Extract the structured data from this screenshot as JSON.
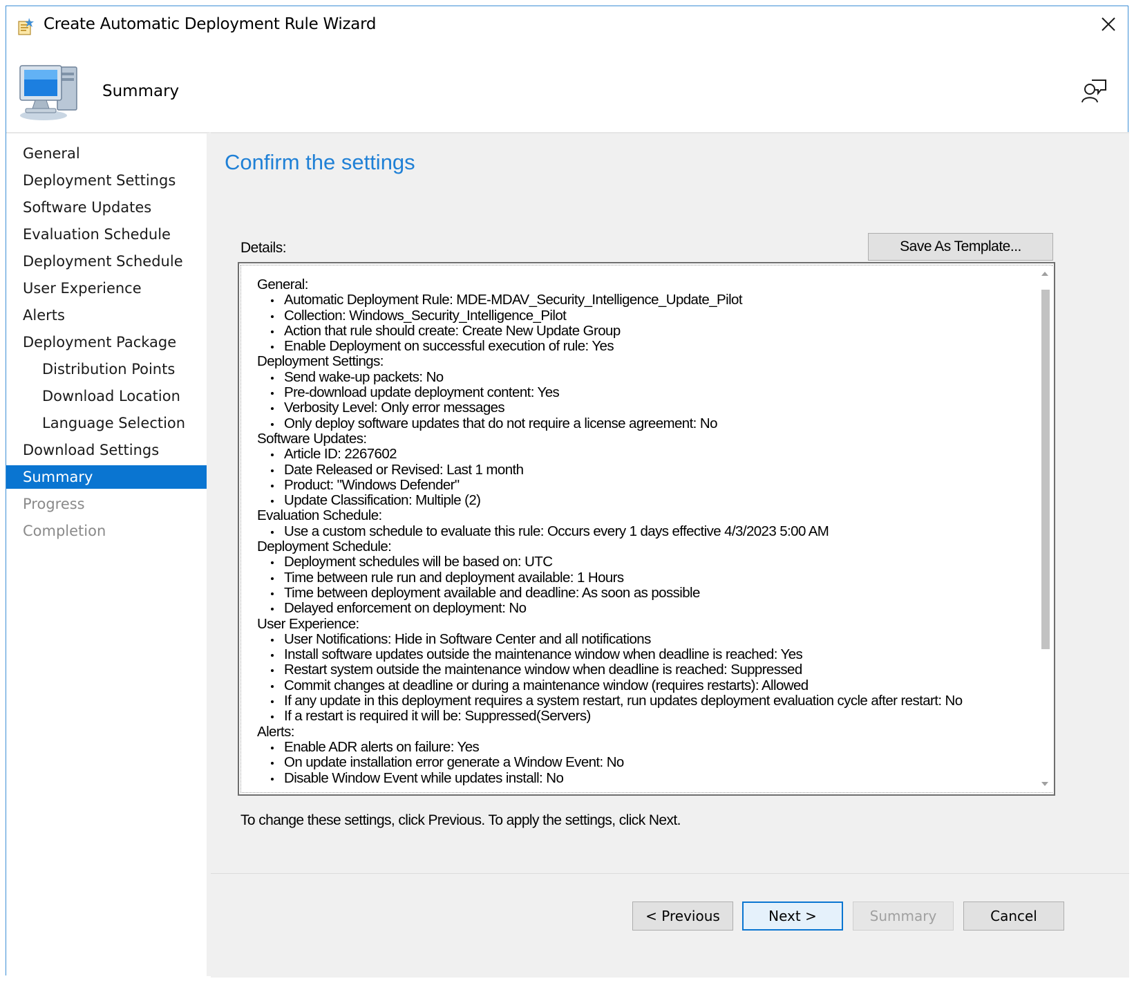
{
  "window": {
    "title": "Create Automatic Deployment Rule Wizard",
    "accent_color": "#0a75d1",
    "heading_color": "#1f80d6"
  },
  "header": {
    "page_title": "Summary"
  },
  "sidebar": {
    "items": [
      {
        "label": "General",
        "state": "normal",
        "level": 0
      },
      {
        "label": "Deployment Settings",
        "state": "normal",
        "level": 0
      },
      {
        "label": "Software Updates",
        "state": "normal",
        "level": 0
      },
      {
        "label": "Evaluation Schedule",
        "state": "normal",
        "level": 0
      },
      {
        "label": "Deployment Schedule",
        "state": "normal",
        "level": 0
      },
      {
        "label": "User Experience",
        "state": "normal",
        "level": 0
      },
      {
        "label": "Alerts",
        "state": "normal",
        "level": 0
      },
      {
        "label": "Deployment Package",
        "state": "normal",
        "level": 0
      },
      {
        "label": "Distribution Points",
        "state": "normal",
        "level": 1
      },
      {
        "label": "Download Location",
        "state": "normal",
        "level": 1
      },
      {
        "label": "Language Selection",
        "state": "normal",
        "level": 1
      },
      {
        "label": "Download Settings",
        "state": "normal",
        "level": 0
      },
      {
        "label": "Summary",
        "state": "active",
        "level": 0
      },
      {
        "label": "Progress",
        "state": "disabled",
        "level": 0
      },
      {
        "label": "Completion",
        "state": "disabled",
        "level": 0
      }
    ]
  },
  "main": {
    "heading": "Confirm the settings",
    "details_label": "Details:",
    "save_template_label": "Save As Template...",
    "footer_hint": "To change these settings, click Previous. To apply the settings, click Next.",
    "details": [
      {
        "section": "General:",
        "items": [
          "Automatic Deployment Rule: MDE-MDAV_Security_Intelligence_Update_Pilot",
          "Collection: Windows_Security_Intelligence_Pilot",
          "Action that rule should create: Create New Update Group",
          "Enable Deployment on successful execution of rule: Yes"
        ]
      },
      {
        "section": "Deployment Settings:",
        "items": [
          "Send wake-up packets: No",
          "Pre-download update deployment content: Yes",
          "Verbosity Level: Only error messages",
          "Only deploy software updates that do not require a license agreement: No"
        ]
      },
      {
        "section": "Software Updates:",
        "items": [
          "Article ID: 2267602",
          "Date Released or Revised: Last 1 month",
          "Product: \"Windows Defender\"",
          "Update Classification: Multiple (2)"
        ]
      },
      {
        "section": "Evaluation Schedule:",
        "items": [
          "Use a custom schedule to evaluate this rule: Occurs every 1 days effective 4/3/2023 5:00 AM"
        ]
      },
      {
        "section": "Deployment Schedule:",
        "items": [
          "Deployment schedules will be based on: UTC",
          "Time between rule run and deployment available: 1 Hours",
          "Time between deployment available and deadline: As soon as possible",
          "Delayed enforcement on deployment: No"
        ]
      },
      {
        "section": "User Experience:",
        "items": [
          "User Notifications: Hide in Software Center and all notifications",
          "Install software updates outside the maintenance window when deadline is reached: Yes",
          "Restart system outside the maintenance window when deadline is reached: Suppressed",
          "Commit changes at deadline or during a maintenance window (requires restarts): Allowed",
          "If any update in this deployment requires a system restart, run updates deployment evaluation cycle after restart: No",
          "If a restart is required it will be: Suppressed(Servers)"
        ]
      },
      {
        "section": "Alerts:",
        "items": [
          "Enable ADR alerts on failure: Yes",
          "On update installation error generate a Window Event: No",
          "Disable Window Event while updates install: No"
        ]
      }
    ]
  },
  "buttons": {
    "previous": "< Previous",
    "next": "Next >",
    "summary": "Summary",
    "cancel": "Cancel"
  },
  "icons": {
    "title": "wizard-icon",
    "close": "close-icon",
    "header": "computer-icon",
    "feedback": "feedback-icon",
    "scroll_up": "scroll-up-arrow-icon",
    "scroll_down": "scroll-down-arrow-icon"
  }
}
